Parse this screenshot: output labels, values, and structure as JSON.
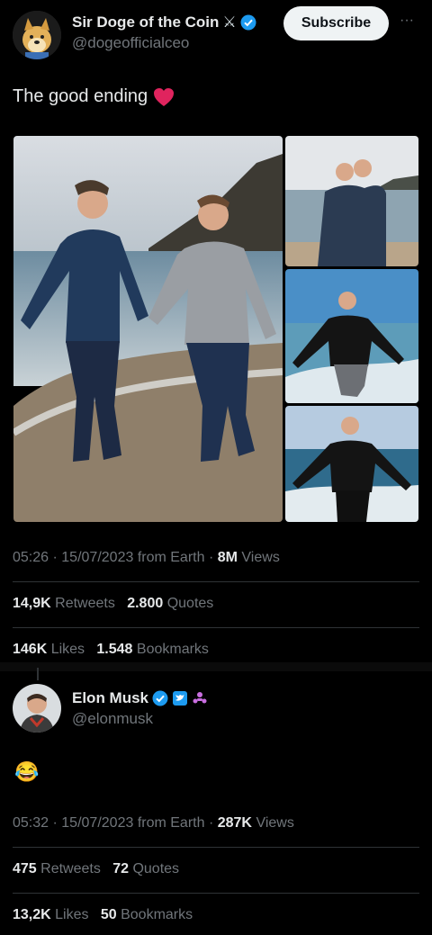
{
  "tweet1": {
    "author_name": "Sir Doge of the Coin",
    "author_emoji": "⚔",
    "handle": "@dogeofficialceo",
    "subscribe_label": "Subscribe",
    "more_label": "···",
    "text": "The good ending",
    "text_emoji": "❤️",
    "time": "05:26",
    "date": "15/07/2023",
    "source": "from Earth",
    "views_count": "8M",
    "views_label": "Views",
    "retweets_count": "14,9K",
    "retweets_label": "Retweets",
    "quotes_count": "2.800",
    "quotes_label": "Quotes",
    "likes_count": "146K",
    "likes_label": "Likes",
    "bookmarks_count": "1.548",
    "bookmarks_label": "Bookmarks"
  },
  "tweet2": {
    "author_name": "Elon Musk",
    "handle": "@elonmusk",
    "text": "😂",
    "time": "05:32",
    "date": "15/07/2023",
    "source": "from Earth",
    "views_count": "287K",
    "views_label": "Views",
    "retweets_count": "475",
    "retweets_label": "Retweets",
    "quotes_count": "72",
    "quotes_label": "Quotes",
    "likes_count": "13,2K",
    "likes_label": "Likes",
    "bookmarks_count": "50",
    "bookmarks_label": "Bookmarks"
  },
  "colors": {
    "background": "#000000",
    "text": "#e7e9ea",
    "secondary_text": "#71767b",
    "verified_blue": "#1d9bf0",
    "divider": "#2f3336"
  }
}
